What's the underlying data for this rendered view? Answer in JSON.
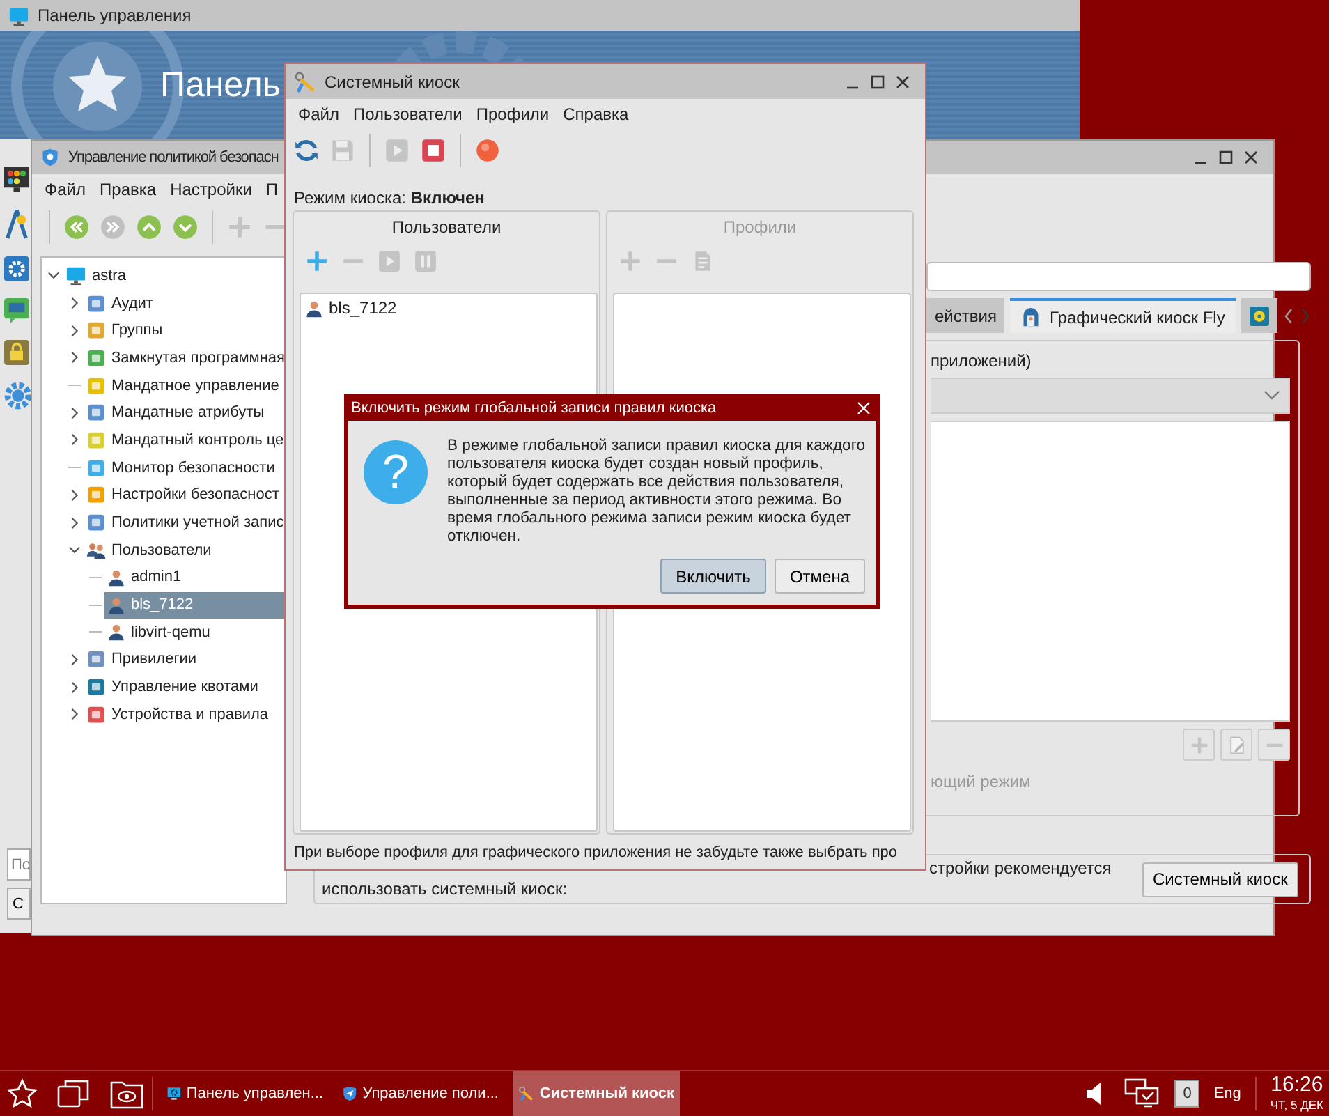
{
  "control_panel": {
    "title": "Панель управления",
    "banner_title": "Панель",
    "search": {
      "placeholder": "По"
    },
    "button": "С"
  },
  "policy_window": {
    "title": "Управление политикой безопасн",
    "menu": [
      "Файл",
      "Правка",
      "Настройки",
      "П"
    ],
    "toolbar": [
      [
        {
          "disabled": false
        },
        {
          "disabled": true
        },
        {
          "disabled": false
        },
        {
          "disabled": false
        }
      ],
      [
        {
          "disabled": true
        },
        {
          "disabled": true
        }
      ]
    ],
    "tree": [
      {
        "label": "astra",
        "kind": "computer",
        "expandable": true,
        "expanded": true,
        "selected": false,
        "children": [
          {
            "label": "Аудит",
            "kind": "category",
            "expandable": true,
            "expanded": false,
            "selected": false
          },
          {
            "label": "Группы",
            "kind": "category",
            "expandable": true,
            "expanded": false,
            "selected": false
          },
          {
            "label": "Замкнутая программная",
            "kind": "category",
            "expandable": true,
            "expanded": false,
            "selected": false
          },
          {
            "label": "Мандатное управление",
            "kind": "category",
            "expandable": false,
            "expanded": false,
            "selected": false
          },
          {
            "label": "Мандатные атрибуты",
            "kind": "category",
            "expandable": true,
            "expanded": false,
            "selected": false
          },
          {
            "label": "Мандатный контроль це",
            "kind": "category",
            "expandable": true,
            "expanded": false,
            "selected": false
          },
          {
            "label": "Монитор безопасности",
            "kind": "category",
            "expandable": false,
            "expanded": false,
            "selected": false
          },
          {
            "label": "Настройки безопасност",
            "kind": "category",
            "expandable": true,
            "expanded": false,
            "selected": false
          },
          {
            "label": "Политики учетной запис",
            "kind": "category",
            "expandable": true,
            "expanded": false,
            "selected": false
          },
          {
            "label": "Пользователи",
            "kind": "users",
            "expandable": true,
            "expanded": true,
            "selected": false,
            "children": [
              {
                "label": "admin1",
                "kind": "user",
                "expandable": false,
                "expanded": false,
                "selected": false
              },
              {
                "label": "bls_7122",
                "kind": "user",
                "expandable": false,
                "expanded": false,
                "selected": true
              },
              {
                "label": "libvirt-qemu",
                "kind": "user",
                "expandable": false,
                "expanded": false,
                "selected": false
              }
            ]
          },
          {
            "label": "Привилегии",
            "kind": "category",
            "expandable": true,
            "expanded": false,
            "selected": false
          },
          {
            "label": "Управление квотами",
            "kind": "category",
            "expandable": true,
            "expanded": false,
            "selected": false
          },
          {
            "label": "Устройства и правила",
            "kind": "category",
            "expandable": true,
            "expanded": false,
            "selected": false
          }
        ]
      }
    ],
    "tabs": [
      {
        "label": "ействия",
        "selected": false
      },
      {
        "label": "Графический киоск Fly",
        "selected": true
      },
      {
        "selected": false
      }
    ],
    "group_title": "приложений)",
    "list_buttons": [
      {
        "disabled": true
      },
      {
        "disabled": true
      },
      {
        "disabled": true
      }
    ],
    "mode_option": {
      "label": "ющий режим",
      "disabled": true
    },
    "hint_lines": [
      "стройки рекомендуется",
      "использовать системный киоск:"
    ],
    "hint_button": "Системный киоск"
  },
  "kiosk_window": {
    "title": "Системный киоск",
    "menu": [
      "Файл",
      "Пользователи",
      "Профили",
      "Справка"
    ],
    "toolbar": [
      [
        {
          "disabled": false
        },
        {
          "disabled": true
        }
      ],
      [
        {
          "disabled": true
        },
        {
          "disabled": false
        }
      ],
      [
        {
          "disabled": false
        }
      ]
    ],
    "mode": "Режим киоска: **Включен**",
    "panels": [
      {
        "title": "Пользователи",
        "disabled": false,
        "toolbar": [
          {
            "disabled": false
          },
          {
            "disabled": true
          },
          {
            "disabled": true
          },
          {
            "disabled": true
          }
        ],
        "items": [
          {
            "name": "bls_7122",
            "selected": false
          }
        ]
      },
      {
        "title": "Профили",
        "disabled": true,
        "toolbar": [
          {
            "disabled": true
          },
          {
            "disabled": true
          },
          {
            "disabled": true
          }
        ]
      }
    ],
    "footer": "При выборе профиля для графического приложения не забудьте также выбрать про"
  },
  "dialog": {
    "title": "Включить режим глобальной записи правил киоска",
    "icon": "?",
    "message": "В режиме глобальной записи правил киоска для каждого пользователя киоска будет создан новый профиль, который будет содержать все действия пользователя, выполненные за период активности этого режима. Во время глобального режима записи режим киоска будет отключен.",
    "buttons": [
      {
        "label": "Включить",
        "default": true
      },
      {
        "label": "Отмена",
        "default": false
      }
    ]
  },
  "taskbar": {
    "tasks": [
      {
        "label": "Панель управлен...",
        "selected": false
      },
      {
        "label": "Управление поли...",
        "selected": false
      },
      {
        "label": "Системный киоск",
        "selected": true
      }
    ],
    "notifications": "0",
    "keyboard_layout": "Eng",
    "time": "16:26",
    "date": "ЧТ, 5 ДЕК"
  }
}
